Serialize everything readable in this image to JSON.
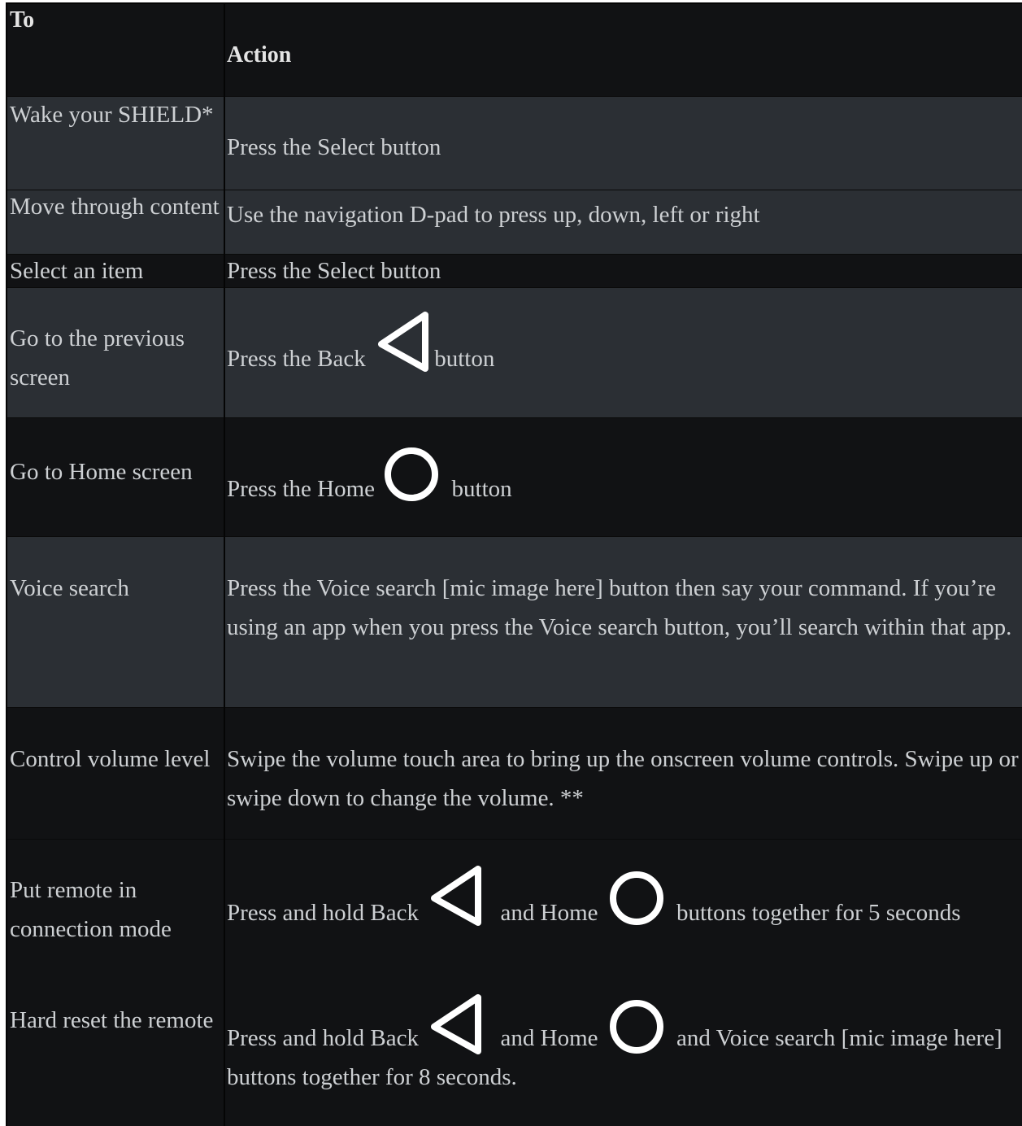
{
  "header": {
    "col_to": "To",
    "col_action": "Action"
  },
  "icons": {
    "back": "back-triangle-icon",
    "home": "home-circle-icon"
  },
  "rows": [
    {
      "to": "Wake your SHIELD*",
      "action": "Press the Select button"
    },
    {
      "to": "Move through content",
      "action": "Use the navigation D-pad to press up, down, left or right"
    },
    {
      "to": "Select an item",
      "action": "Press the Select button"
    },
    {
      "to": "Go to the previous screen",
      "action_pre": "Press the Back ",
      "action_post": "button"
    },
    {
      "to": "Go to Home screen",
      "action_pre": "Press the Home ",
      "action_post": "button"
    },
    {
      "to": "Voice search",
      "action": "Press the Voice search [mic image here] button then say your command. If you’re using an app when you press the Voice search button, you’ll search within that app."
    },
    {
      "to": "Control volume level",
      "action": "Swipe the volume touch area to bring up the onscreen volume controls. Swipe up or swipe down to change the volume. **"
    },
    {
      "to": "Put remote in connection mode",
      "action_pre": "Press and hold Back ",
      "action_mid": " and Home ",
      "action_post": " buttons together for 5 seconds"
    },
    {
      "to": "Hard reset the remote",
      "action_pre": "Press and hold Back ",
      "action_mid": " and Home ",
      "action_post": " and Voice search [mic image here] buttons together for 8 seconds."
    }
  ]
}
